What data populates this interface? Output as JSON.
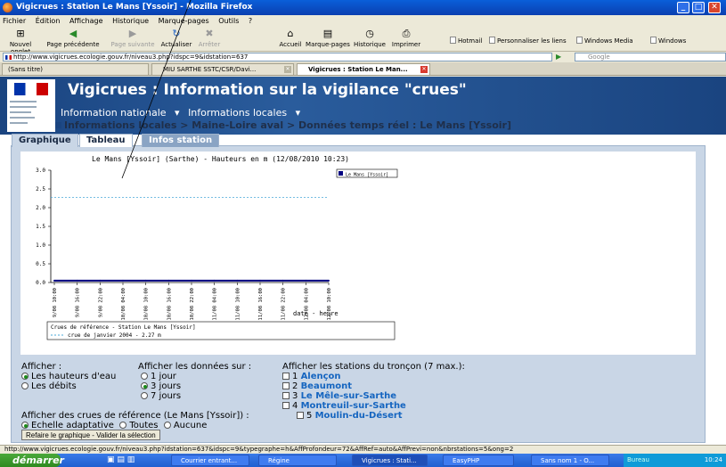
{
  "window": {
    "title": "Vigicrues : Station Le Mans [Yssoir] - Mozilla Firefox"
  },
  "menu": [
    "Fichier",
    "Édition",
    "Affichage",
    "Historique",
    "Marque-pages",
    "Outils",
    "?"
  ],
  "toolbar": {
    "new_tab": "Nouvel onglet",
    "prev": "Page précédente",
    "next": "Page suivante",
    "reload": "Actualiser",
    "stop": "Arrêter",
    "home": "Accueil",
    "bookmarks": "Marque-pages",
    "history": "Historique",
    "print": "Imprimer",
    "bookmark_links": [
      "Hotmail",
      "Personnaliser les liens",
      "Windows Media",
      "Windows"
    ]
  },
  "url": "http://www.vigicrues.ecologie.gouv.fr/niveau3.php?idspc=9&idstation=637",
  "search_placeholder": "Google",
  "tabs": [
    {
      "label": "(Sans titre)"
    },
    {
      "label": "MIU SARTHE SSTC/CSR/Davi..."
    },
    {
      "label": "Vigicrues : Station Le Man..."
    }
  ],
  "page": {
    "title": "Vigicrues : Information sur la vigilance \"crues\"",
    "nav1": "Information nationale",
    "nav2": "Informations locales",
    "breadcrumb": "Informations locales > Maine-Loire aval > Données temps réel : Le Mans [Yssoir]",
    "tabs": [
      "Graphique",
      "Tableau",
      "Infos station"
    ]
  },
  "chart_data": {
    "type": "line",
    "title": "Le Mans [Yssoir] (Sarthe) - Hauteurs en m (12/08/2010 10:23)",
    "xlabel": "date - heure",
    "ylabel": "",
    "ylim": [
      0,
      3.0
    ],
    "yticks": [
      "0.0",
      "0.5",
      "1.0",
      "1.5",
      "2.0",
      "2.5",
      "3.0"
    ],
    "xticks": [
      "9/08 10:00",
      "9/08 16:00",
      "9/08 22:00",
      "10/08 04:00",
      "10/08 10:00",
      "10/08 16:00",
      "10/08 22:00",
      "11/08 04:00",
      "11/08 10:00",
      "11/08 16:00",
      "11/08 22:00",
      "12/08 04:00",
      "12/08 10:00"
    ],
    "series": [
      {
        "name": "Le Mans [Yssoir]",
        "x_range": [
          "9/08 10:00",
          "12/08 10:00"
        ],
        "values": [
          0.05,
          0.05,
          0.05,
          0.05,
          0.05,
          0.05,
          0.05,
          0.05,
          0.05,
          0.05,
          0.05,
          0.05,
          0.05
        ]
      }
    ],
    "reference": {
      "label": "crue de janvier 2004 - 2.27 m",
      "value": 2.27
    },
    "reference_box_title": "Crues de référence - Station Le Mans [Yssoir]",
    "legend": "top-right",
    "grid": false,
    "colors": {
      "series": "#000080",
      "reference": "#48a8d8"
    }
  },
  "options": {
    "afficher_label": "Afficher :",
    "afficher": [
      "Les hauteurs d'eau",
      "Les débits"
    ],
    "donnees_label": "Afficher les données sur :",
    "donnees": [
      "1 jour",
      "3 jours",
      "7 jours"
    ],
    "stations_label": "Afficher les stations du tronçon (7 max.):",
    "stations": [
      {
        "num": "1",
        "name": "Alençon"
      },
      {
        "num": "2",
        "name": "Beaumont"
      },
      {
        "num": "3",
        "name": "Le Mêle-sur-Sarthe"
      },
      {
        "num": "4",
        "name": "Montreuil-sur-Sarthe"
      },
      {
        "num": "5",
        "name": "Moulin-du-Désert"
      }
    ],
    "crues_label": "Afficher des crues de référence (Le Mans [Yssoir]) :",
    "crues": [
      "Echelle adaptative",
      "Toutes",
      "Aucune"
    ],
    "button": "Refaire le graphique - Valider la sélection"
  },
  "status": "http://www.vigicrues.ecologie.gouv.fr/niveau3.php?idstation=637&idspc=9&typegraphe=h&AffProfondeur=72&AffRef=auto&AffPrevi=non&nbrstations=5&ong=2",
  "taskbar": {
    "start": "démarrer",
    "items": [
      "Courrier entrant...",
      "Régine",
      "Vigicrues : Stati...",
      "EasyPHP",
      "Sans nom 1 - O..."
    ],
    "tray_label": "Bureau",
    "clock": "10:24"
  }
}
